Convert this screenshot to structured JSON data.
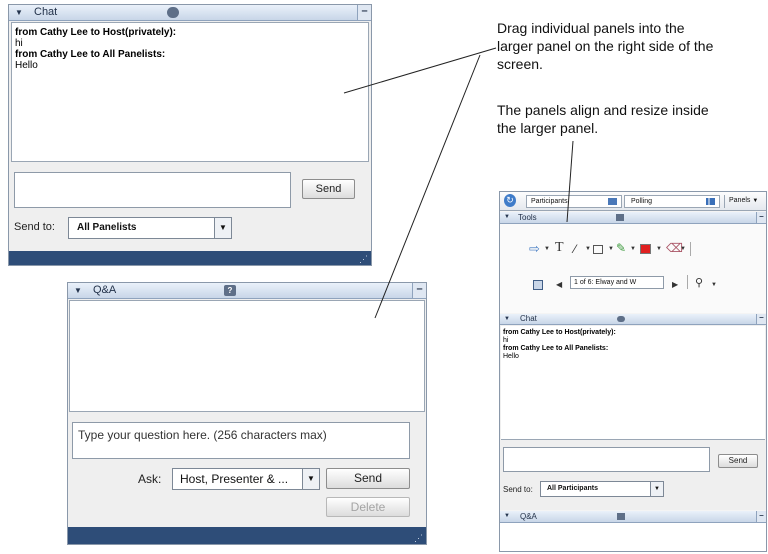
{
  "chat_panel": {
    "title": "Chat",
    "messages": [
      {
        "sender": "from Cathy Lee to Host(privately):",
        "text": "hi"
      },
      {
        "sender": "from Cathy Lee to All Panelists:",
        "text": "Hello"
      }
    ],
    "send_label": "Send",
    "send_to_label": "Send to:",
    "send_to_value": "All Panelists"
  },
  "qa_panel": {
    "title": "Q&A",
    "question_placeholder": "Type your question here. (256 characters max)",
    "ask_label": "Ask:",
    "ask_value": "Host, Presenter & ...",
    "send_label": "Send",
    "delete_label": "Delete"
  },
  "annotations": {
    "drag_lines": [
      "Drag individual panels into the",
      "larger panel on the right side of the",
      "screen."
    ],
    "align_lines": [
      "The panels align and resize inside",
      "the larger panel."
    ]
  },
  "right_window": {
    "toolbar": {
      "participants_label": "Participants",
      "polling_label": "Polling",
      "panels_label": "Panels"
    },
    "tools_panel": {
      "title": "Tools",
      "page_select_value": "1 of 6: Elway and W",
      "tool_icons": [
        "pointer-icon",
        "text-tool-icon",
        "line-tool-icon",
        "rectangle-tool-icon",
        "highlighter-icon",
        "color-picker-icon",
        "eraser-icon",
        "save-icon",
        "previous-page-icon",
        "next-page-icon",
        "zoom-icon"
      ]
    },
    "chat_panel": {
      "title": "Chat",
      "messages": [
        {
          "sender": "from Cathy Lee to Host(privately):",
          "text": "hi"
        },
        {
          "sender": "from Cathy Lee to All Panelists:",
          "text": "Hello"
        }
      ],
      "send_label": "Send",
      "send_to_label": "Send to:",
      "send_to_value": "All Participants"
    },
    "qa_panel": {
      "title": "Q&A"
    }
  },
  "colors": {
    "titlebar_top": "#eaf1fa",
    "titlebar_bottom": "#c8d6e8",
    "footer": "#2e4d78",
    "panel_bg": "#efefef",
    "annotation_line": "#222222",
    "color_swatch": "#e02020"
  }
}
